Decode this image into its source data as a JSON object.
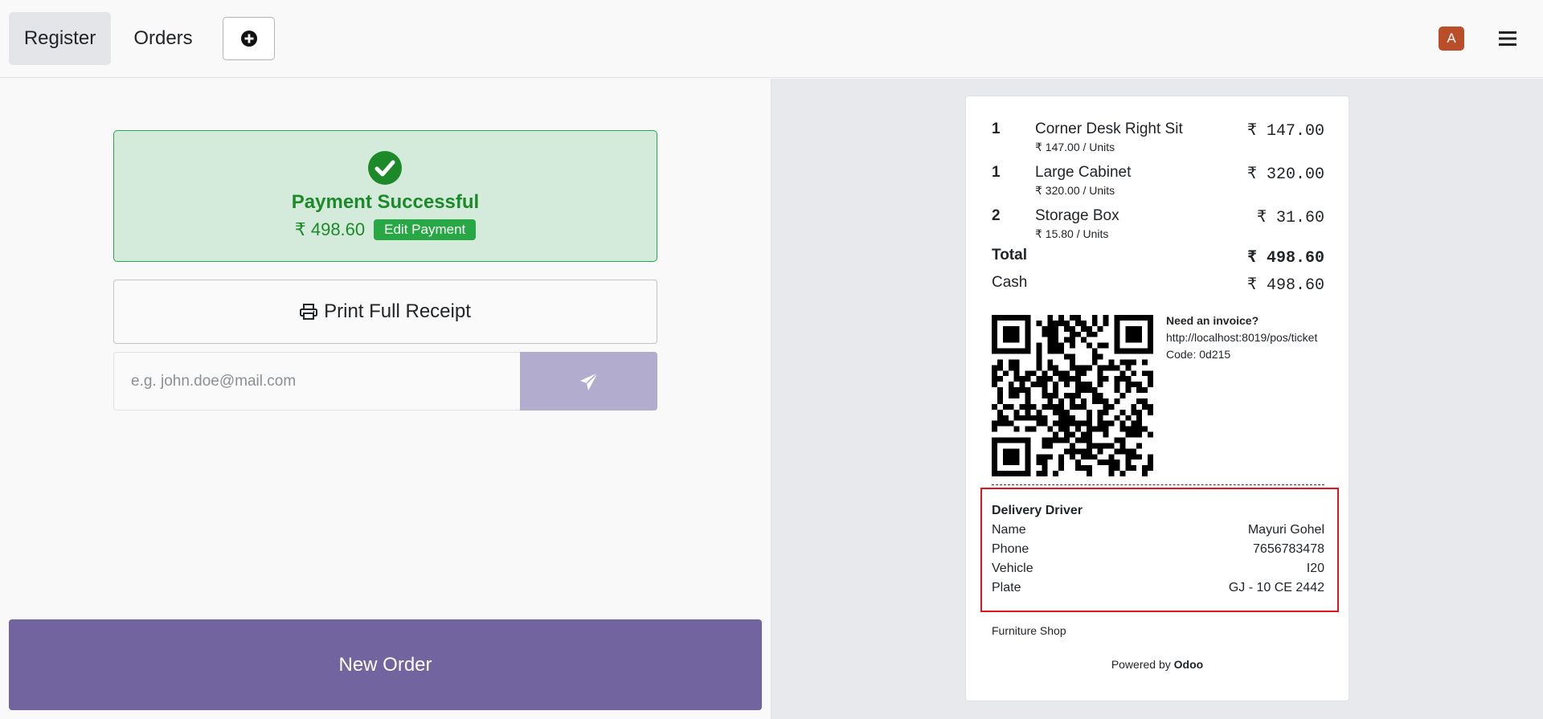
{
  "topbar": {
    "register_label": "Register",
    "orders_label": "Orders",
    "avatar_initial": "A"
  },
  "payment": {
    "title": "Payment Successful",
    "amount": "₹ 498.60",
    "edit_label": "Edit Payment",
    "print_label": "Print Full Receipt",
    "email_placeholder": "e.g. john.doe@mail.com",
    "new_order_label": "New Order"
  },
  "receipt": {
    "lines": [
      {
        "qty": "1",
        "name": "Corner Desk Right Sit",
        "unit": "₹ 147.00 / Units",
        "price": "₹ 147.00"
      },
      {
        "qty": "1",
        "name": "Large Cabinet",
        "unit": "₹ 320.00 / Units",
        "price": "₹ 320.00"
      },
      {
        "qty": "2",
        "name": "Storage Box",
        "unit": "₹ 15.80 / Units",
        "price": "₹ 31.60"
      }
    ],
    "total_label": "Total",
    "total_value": "₹ 498.60",
    "cash_label": "Cash",
    "cash_value": "₹ 498.60",
    "invoice_question": "Need an invoice?",
    "invoice_url": "http://localhost:8019/pos/ticket",
    "invoice_code": "Code: 0d215",
    "driver": {
      "heading": "Delivery Driver",
      "rows": [
        {
          "label": "Name",
          "value": "Mayuri Gohel"
        },
        {
          "label": "Phone",
          "value": "7656783478"
        },
        {
          "label": "Vehicle",
          "value": "I20"
        },
        {
          "label": "Plate",
          "value": "GJ - 10 CE 2442"
        }
      ]
    },
    "shop_name": "Furniture Shop",
    "powered_prefix": "Powered by",
    "powered_brand": "Odoo"
  },
  "colors": {
    "accent": "#72649e",
    "success": "#28a745",
    "highlight_border": "#e0161c",
    "avatar": "#b94e28"
  },
  "icons": {
    "add": "plus-circle-icon",
    "menu": "hamburger-icon",
    "success": "check-circle-icon",
    "print": "printer-icon",
    "send": "paper-plane-icon"
  }
}
